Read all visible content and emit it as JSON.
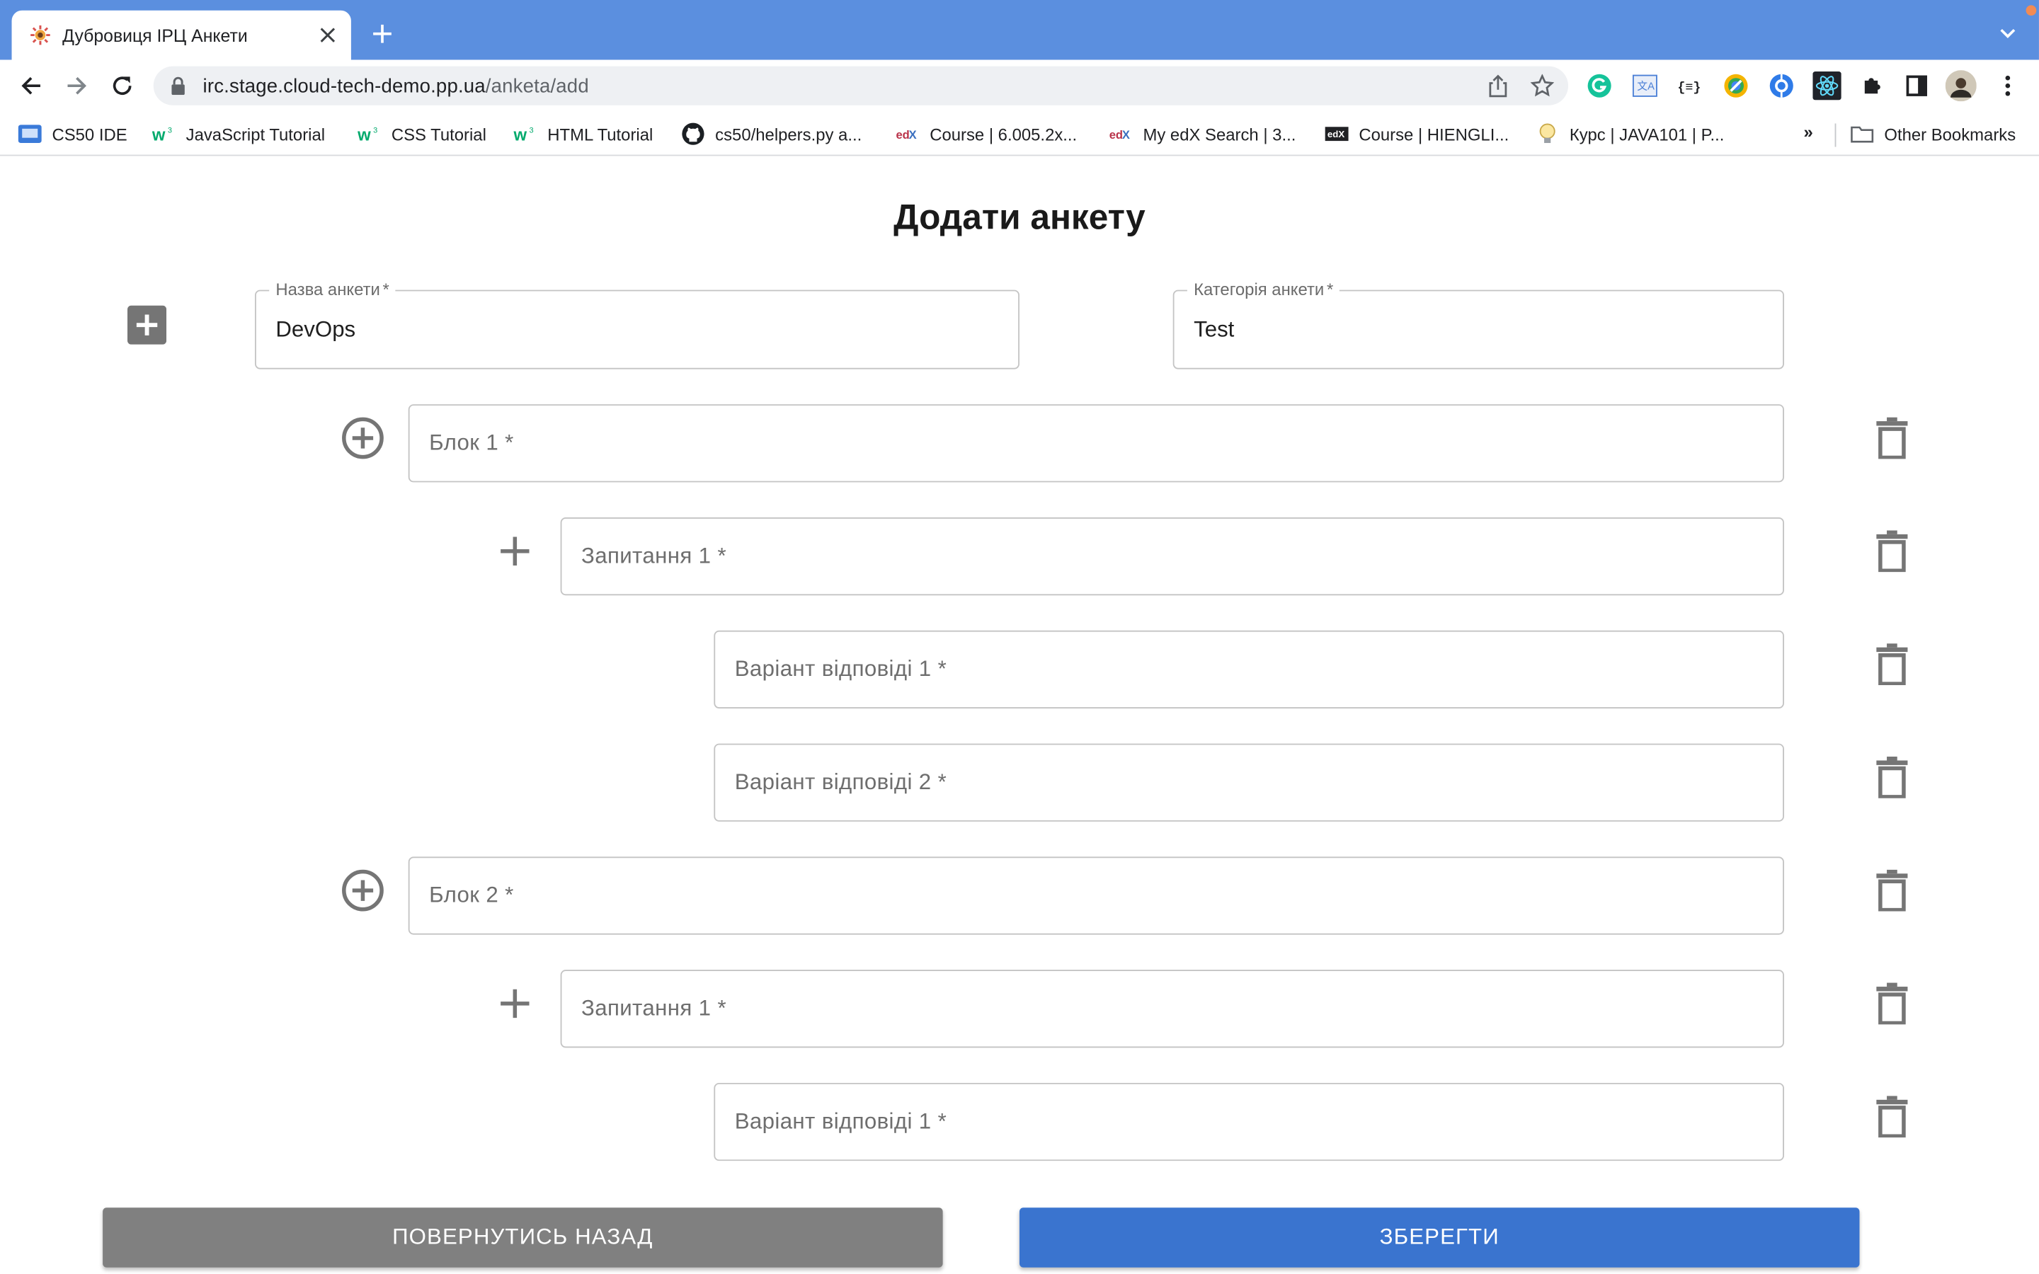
{
  "browser": {
    "tab_title": "Дубровиця ІРЦ Анкети",
    "url_host": "irc.stage.cloud-tech-demo.pp.ua",
    "url_path": "/anketa/add",
    "bookmarks": [
      {
        "label": "CS50 IDE",
        "icon": "cs50-icon"
      },
      {
        "label": "JavaScript Tutorial",
        "icon": "w3schools-icon"
      },
      {
        "label": "CSS Tutorial",
        "icon": "w3schools-icon"
      },
      {
        "label": "HTML Tutorial",
        "icon": "w3schools-icon"
      },
      {
        "label": "cs50/helpers.py a...",
        "icon": "github-icon"
      },
      {
        "label": "Course | 6.005.2x...",
        "icon": "edx-icon"
      },
      {
        "label": "My edX Search | 3...",
        "icon": "edx-icon"
      },
      {
        "label": "Course | HIENGLI...",
        "icon": "edx-icon"
      },
      {
        "label": "Курс | JAVA101 | P...",
        "icon": "bulb-icon"
      }
    ],
    "bookmarks_overflow": "»",
    "other_bookmarks": "Other Bookmarks"
  },
  "page": {
    "title": "Додати анкету",
    "name_field": {
      "label": "Назва анкети",
      "required": "*",
      "value": "DevOps"
    },
    "category_field": {
      "label": "Категорія анкети",
      "required": "*",
      "value": "Test"
    },
    "rows": [
      {
        "kind": "block",
        "placeholder": "Блок 1",
        "required": "*"
      },
      {
        "kind": "question",
        "placeholder": "Запитання 1",
        "required": "*"
      },
      {
        "kind": "answer",
        "placeholder": "Варіант відповіді 1",
        "required": "*"
      },
      {
        "kind": "answer",
        "placeholder": "Варіант відповіді 2",
        "required": "*"
      },
      {
        "kind": "block",
        "placeholder": "Блок 2",
        "required": "*"
      },
      {
        "kind": "question",
        "placeholder": "Запитання 1",
        "required": "*"
      },
      {
        "kind": "answer",
        "placeholder": "Варіант відповіді 1",
        "required": "*"
      }
    ],
    "back_button": "ПОВЕРНУТИСЬ НАЗАД",
    "save_button": "ЗБЕРЕГТИ"
  },
  "colors": {
    "tabbar": "#5b8fdf",
    "primary_button": "#3a74cf",
    "secondary_button": "#808080",
    "icon_gray": "#757575"
  }
}
